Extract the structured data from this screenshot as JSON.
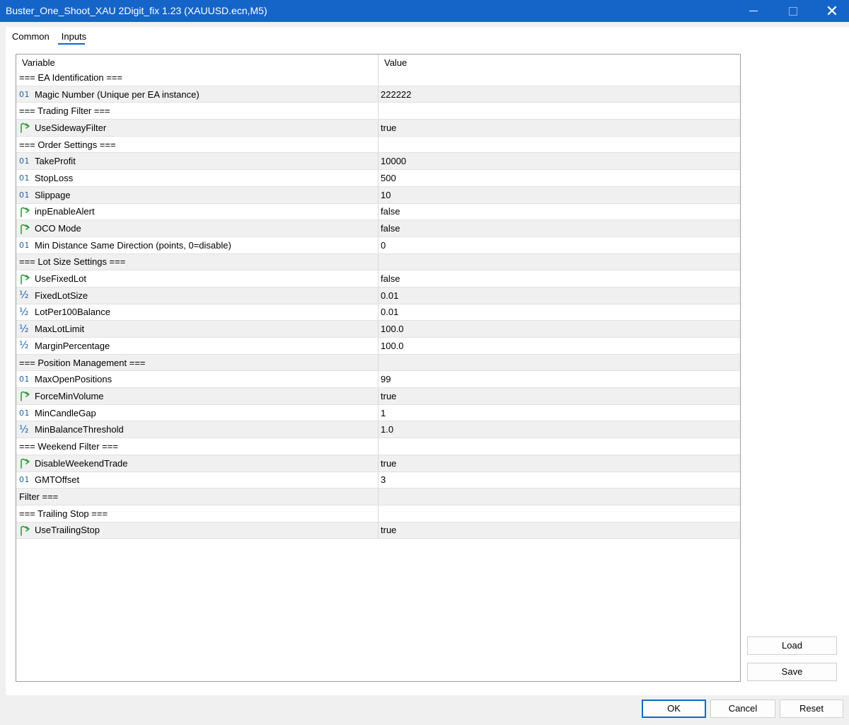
{
  "window": {
    "title": "Buster_One_Shoot_XAU 2Digit_fix 1.23 (XAUUSD.ecn,M5)",
    "controls": [
      "minimize-icon",
      "maximize-icon",
      "close-icon"
    ]
  },
  "tabs": [
    {
      "label": "Common",
      "active": false
    },
    {
      "label": "Inputs",
      "active": true
    }
  ],
  "grid": {
    "columns": {
      "variable": "Variable",
      "value": "Value"
    },
    "rows": [
      {
        "type": "section",
        "icon": "",
        "name": "=== EA Identification ===",
        "value": ""
      },
      {
        "type": "int",
        "icon": "01",
        "name": "Magic Number (Unique per EA instance)",
        "value": "222222"
      },
      {
        "type": "section",
        "icon": "",
        "name": "=== Trading Filter ===",
        "value": ""
      },
      {
        "type": "bool",
        "icon": "",
        "name": "UseSidewayFilter",
        "value": "true"
      },
      {
        "type": "section",
        "icon": "",
        "name": "=== Order Settings ===",
        "value": ""
      },
      {
        "type": "int",
        "icon": "01",
        "name": "TakeProfit",
        "value": "10000"
      },
      {
        "type": "int",
        "icon": "01",
        "name": "StopLoss",
        "value": "500"
      },
      {
        "type": "int",
        "icon": "01",
        "name": "Slippage",
        "value": "10"
      },
      {
        "type": "bool",
        "icon": "",
        "name": "inpEnableAlert",
        "value": "false"
      },
      {
        "type": "bool",
        "icon": "",
        "name": "OCO Mode",
        "value": "false"
      },
      {
        "type": "int",
        "icon": "01",
        "name": "Min Distance Same Direction (points, 0=disable)",
        "value": "0"
      },
      {
        "type": "section",
        "icon": "",
        "name": "=== Lot Size Settings ===",
        "value": ""
      },
      {
        "type": "bool",
        "icon": "",
        "name": "UseFixedLot",
        "value": "false"
      },
      {
        "type": "double",
        "icon": "½",
        "name": "FixedLotSize",
        "value": "0.01"
      },
      {
        "type": "double",
        "icon": "½",
        "name": "LotPer100Balance",
        "value": "0.01"
      },
      {
        "type": "double",
        "icon": "½",
        "name": "MaxLotLimit",
        "value": "100.0"
      },
      {
        "type": "double",
        "icon": "½",
        "name": "MarginPercentage",
        "value": "100.0"
      },
      {
        "type": "section",
        "icon": "",
        "name": "=== Position Management ===",
        "value": ""
      },
      {
        "type": "int",
        "icon": "01",
        "name": "MaxOpenPositions",
        "value": "99"
      },
      {
        "type": "bool",
        "icon": "",
        "name": "ForceMinVolume",
        "value": "true"
      },
      {
        "type": "int",
        "icon": "01",
        "name": "MinCandleGap",
        "value": "1"
      },
      {
        "type": "double",
        "icon": "½",
        "name": "MinBalanceThreshold",
        "value": "1.0"
      },
      {
        "type": "section",
        "icon": "",
        "name": "=== Weekend Filter ===",
        "value": ""
      },
      {
        "type": "bool",
        "icon": "",
        "name": "DisableWeekendTrade",
        "value": "true"
      },
      {
        "type": "int",
        "icon": "01",
        "name": "GMTOffset",
        "value": "3"
      },
      {
        "type": "section",
        "icon": "",
        "name": "Filter ===",
        "value": ""
      },
      {
        "type": "section",
        "icon": "",
        "name": "=== Trailing Stop ===",
        "value": ""
      },
      {
        "type": "bool",
        "icon": "",
        "name": "UseTrailingStop",
        "value": "true"
      }
    ]
  },
  "side_buttons": {
    "load": "Load",
    "save": "Save"
  },
  "footer_buttons": {
    "ok": "OK",
    "cancel": "Cancel",
    "reset": "Reset"
  },
  "colors": {
    "titlebar": "#1565c8",
    "accent": "#0b6bc6",
    "int_icon": "#1a5fb4",
    "bool_icon": "#2e9e3e"
  }
}
